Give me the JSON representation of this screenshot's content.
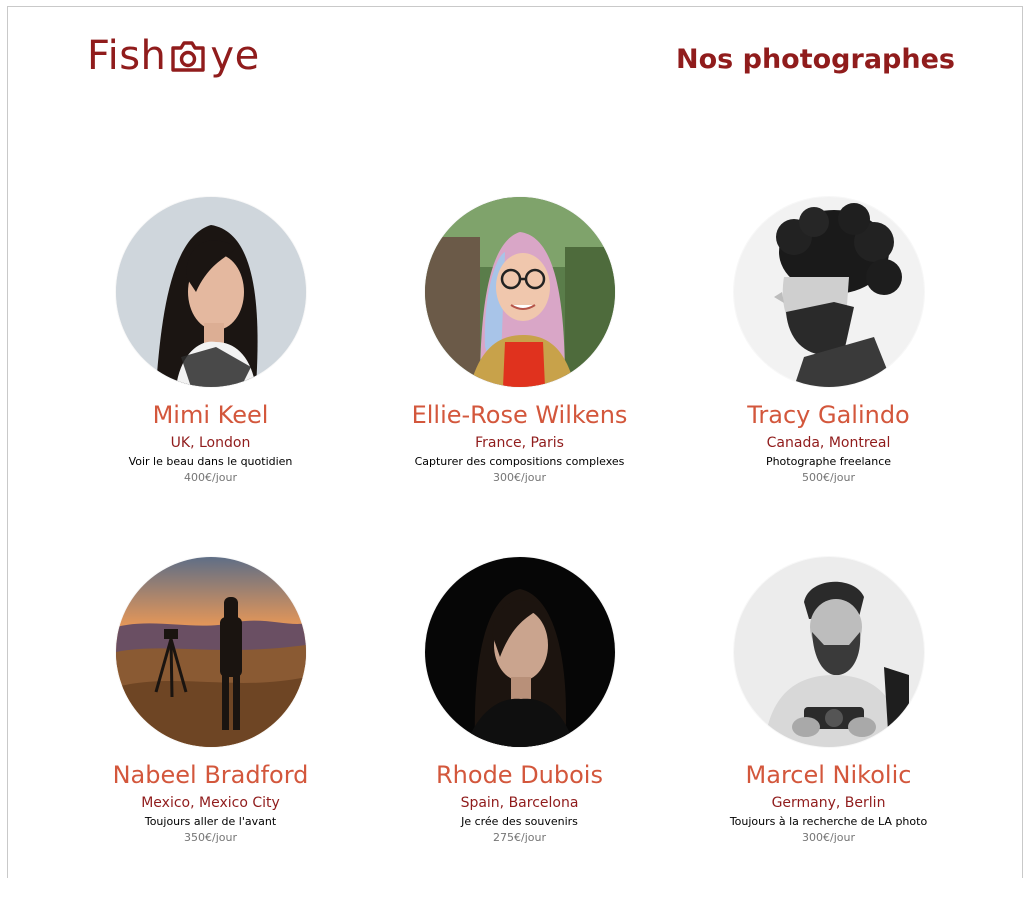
{
  "header": {
    "logo_text_left": "Fish",
    "logo_text_right": "ye",
    "logo_icon": "camera-icon",
    "title": "Nos photographes"
  },
  "colors": {
    "brand": "#901c1c",
    "name": "#d3573c",
    "price": "#757575"
  },
  "photographers": [
    {
      "name": "Mimi Keel",
      "location": "UK, London",
      "tagline": "Voir le beau dans le quotidien",
      "price": "400€/jour",
      "portrait": "portrait-woman-dark-hair-icon"
    },
    {
      "name": "Ellie-Rose Wilkens",
      "location": "France, Paris",
      "tagline": "Capturer des compositions complexes",
      "price": "300€/jour",
      "portrait": "portrait-woman-glasses-icon"
    },
    {
      "name": "Tracy Galindo",
      "location": "Canada, Montreal",
      "tagline": "Photographe freelance",
      "price": "500€/jour",
      "portrait": "portrait-man-curly-hair-icon"
    },
    {
      "name": "Nabeel Bradford",
      "location": "Mexico, Mexico City",
      "tagline": "Toujours aller de l'avant",
      "price": "350€/jour",
      "portrait": "portrait-sunset-landscape-icon"
    },
    {
      "name": "Rhode Dubois",
      "location": "Spain, Barcelona",
      "tagline": "Je crée des souvenirs",
      "price": "275€/jour",
      "portrait": "portrait-woman-dark-background-icon"
    },
    {
      "name": "Marcel Nikolic",
      "location": "Germany, Berlin",
      "tagline": "Toujours à la recherche de LA photo",
      "price": "300€/jour",
      "portrait": "portrait-man-camera-icon"
    }
  ]
}
